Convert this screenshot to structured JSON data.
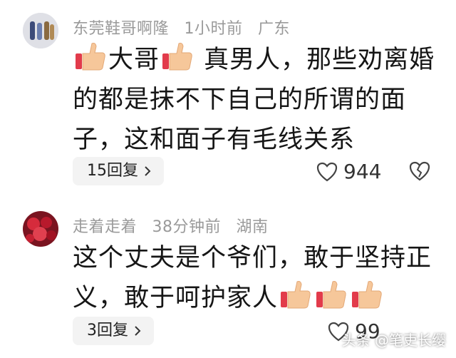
{
  "comments": [
    {
      "username": "东莞鞋哥啊隆",
      "time": "1小时前",
      "location": "广东",
      "text_a": "大哥",
      "text_b": "真男人，那些劝离婚的都是抹不下自己的所谓的面子，这和面子有毛线关系",
      "reply_label": "15回复",
      "likes": "944"
    },
    {
      "username": "走着走着",
      "time": "38分钟前",
      "location": "湖南",
      "text_a": "这个丈夫是个爷们，敢于坚持正义，敢于呵护家人",
      "reply_label": "3回复",
      "likes": "99"
    }
  ],
  "watermark": "头条 @笔吏长缨",
  "colors": {
    "meta": "#9a9a9a",
    "reply_bg": "#f3f3f3",
    "thumb_skin": "#f6c79a",
    "thumb_cuff": "#e23b4b"
  }
}
